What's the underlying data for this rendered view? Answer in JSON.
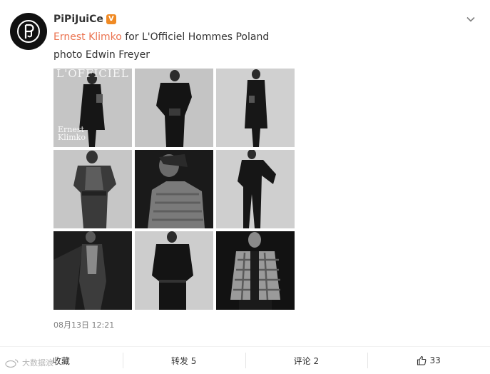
{
  "post": {
    "author": "PiPiJuiCe",
    "verified_badge": "V",
    "avatar_icon": "pj-monogram-logo",
    "line1_mention": "Ernest Klimko",
    "line1_rest": " for L'Officiel Hommes Poland",
    "line2": "photo Edwin Freyer",
    "timestamp": "08月13日 12:21"
  },
  "photos": {
    "cover_masthead": "L'OFFICIEL",
    "cover_name": "Ernest\nKlimko"
  },
  "actions": {
    "favorite": "收藏",
    "repost": "转发 5",
    "comment": "评论 2",
    "like_count": "33"
  },
  "watermark": {
    "text": "大数据浪"
  },
  "colors": {
    "mention": "#eb7350",
    "verified": "#f08a24",
    "timestamp": "#808080"
  }
}
